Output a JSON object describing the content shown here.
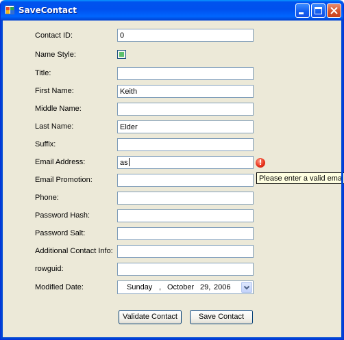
{
  "window": {
    "title": "SaveContact",
    "app_icon": "form-app-icon",
    "controls": [
      "minimize-icon",
      "maximize-icon",
      "close-icon"
    ]
  },
  "form": {
    "labels": {
      "contact_id": "Contact ID:",
      "name_style": "Name Style:",
      "title": "Title:",
      "first_name": "First Name:",
      "middle_name": "Middle Name:",
      "last_name": "Last Name:",
      "suffix": "Suffix:",
      "email_address": "Email Address:",
      "email_promotion": "Email Promotion:",
      "phone": "Phone:",
      "password_hash": "Password Hash:",
      "password_salt": "Password Salt:",
      "additional_contact_info": "Additional Contact Info:",
      "rowguid": "rowguid:",
      "modified_date": "Modified Date:"
    },
    "values": {
      "contact_id": "0",
      "name_style_checked": "indeterminate",
      "title": "",
      "first_name": "Keith",
      "middle_name": "",
      "last_name": "Elder",
      "suffix": "",
      "email_address": "as",
      "email_promotion": "",
      "phone": "",
      "password_hash": "",
      "password_salt": "",
      "additional_contact_info": "",
      "rowguid": ""
    },
    "modified_date": {
      "day_name": "Sunday",
      "separator": ",",
      "month": "October",
      "day": "29,",
      "year": "2006"
    },
    "validation": {
      "icon": "error-icon",
      "icon_glyph": "!",
      "tooltip": "Please enter a valid email a"
    }
  },
  "buttons": {
    "validate": "Validate Contact",
    "save": "Save Contact"
  },
  "colors": {
    "title_bar": "#0053ee",
    "window_face": "#ece9d8",
    "error": "#e8331c",
    "tooltip_bg": "#ffffe1"
  }
}
